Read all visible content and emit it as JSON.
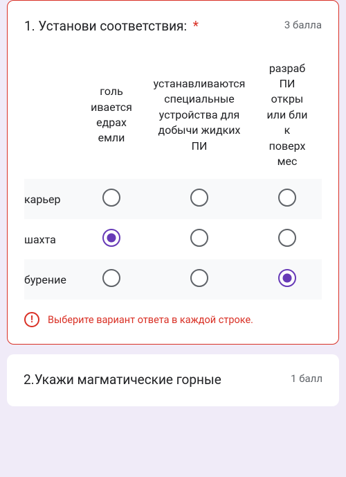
{
  "q1": {
    "title": "1. Установи соответствия:",
    "required_mark": "*",
    "points": "3 балла",
    "cols": [
      "голь\nивается\nедрах\nемли",
      "устанавливаются специальные устройства для добычи жидких ПИ",
      "разраб\nПИ\nоткры\nили бли\nк\nповерх\nмес"
    ],
    "rows": [
      "карьер",
      "шахта",
      "бурение"
    ],
    "selections": {
      "карьер": null,
      "шахта": 0,
      "бурение": 2
    },
    "error": "Выберите вариант ответа в каждой строке."
  },
  "q2": {
    "title": "2.Укажи магматические горные",
    "points": "1 балл"
  },
  "chart_data": {
    "type": "table",
    "title": "1. Установи соответствия:",
    "columns": [
      "голь ивается едрах емли",
      "устанавливаются специальные устройства для добычи жидких ПИ",
      "разраб ПИ откры или бли к поверх мес"
    ],
    "rows": [
      "карьер",
      "шахта",
      "бурение"
    ],
    "values": [
      [
        false,
        false,
        false
      ],
      [
        true,
        false,
        false
      ],
      [
        false,
        false,
        true
      ]
    ]
  }
}
